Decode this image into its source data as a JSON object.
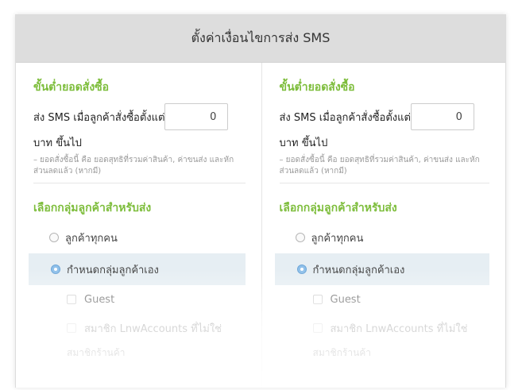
{
  "header": {
    "title": "ตั้งค่าเงื่อนไขการส่ง SMS"
  },
  "columns": [
    {
      "min_order": {
        "title": "ขั้นต่ำยอดสั่งซื้อ",
        "label_before": "ส่ง SMS เมื่อลูกค้าสั่งซื้อตั้งแต่",
        "value": "0",
        "label_after": "บาท ขึ้นไป",
        "note": "– ยอดสั่งซื้อนี้ คือ ยอดสุทธิที่รวมค่าสินค้า, ค่าขนส่ง และหักส่วนลดแล้ว (หากมี)"
      },
      "group": {
        "title": "เลือกกลุ่มลูกค้าสำหรับส่ง",
        "option_all": "ลูกค้าทุกคน",
        "option_custom": "กำหนดกลุ่มลูกค้าเอง",
        "check_guest": "Guest",
        "check_lnw": "สมาชิก LnwAccounts ที่ไม่ใช่",
        "trail": "สมาชิกร้านค้า"
      }
    },
    {
      "min_order": {
        "title": "ขั้นต่ำยอดสั่งซื้อ",
        "label_before": "ส่ง SMS เมื่อลูกค้าสั่งซื้อตั้งแต่",
        "value": "0",
        "label_after": "บาท ขึ้นไป",
        "note": "– ยอดสั่งซื้อนี้ คือ ยอดสุทธิที่รวมค่าสินค้า, ค่าขนส่ง และหักส่วนลดแล้ว (หากมี)"
      },
      "group": {
        "title": "เลือกกลุ่มลูกค้าสำหรับส่ง",
        "option_all": "ลูกค้าทุกคน",
        "option_custom": "กำหนดกลุ่มลูกค้าเอง",
        "check_guest": "Guest",
        "check_lnw": "สมาชิก LnwAccounts ที่ไม่ใช่",
        "trail": "สมาชิกร้านค้า"
      }
    }
  ],
  "colors": {
    "accent_green": "#7dbd3b",
    "header_bg": "#dddddd",
    "selected_bg": "#e6eef3",
    "radio_on": "#8fc0ea"
  }
}
